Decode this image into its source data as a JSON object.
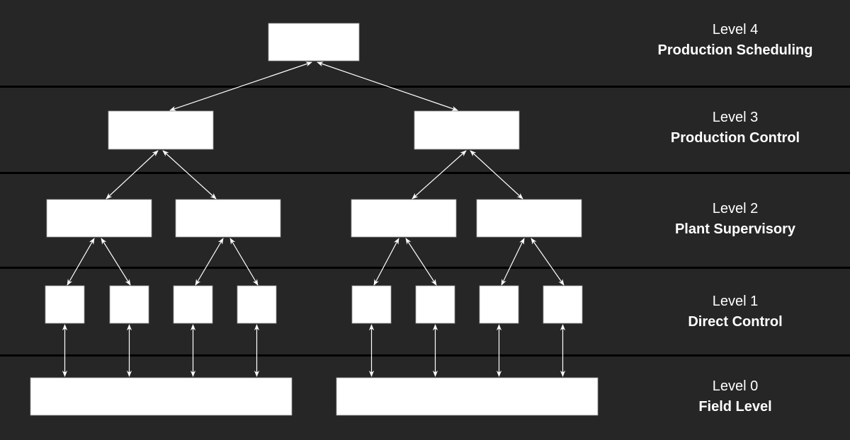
{
  "colors": {
    "background": "#262626",
    "separator": "#000000",
    "box": "#ffffff",
    "arrow": "#ffffff",
    "text": "#ffffff"
  },
  "levels": [
    {
      "number": "Level 4",
      "name": "Production Scheduling"
    },
    {
      "number": "Level 3",
      "name": "Production Control"
    },
    {
      "number": "Level 2",
      "name": "Plant Supervisory"
    },
    {
      "number": "Level 1",
      "name": "Direct Control"
    },
    {
      "number": "Level 0",
      "name": "Field Level"
    }
  ]
}
